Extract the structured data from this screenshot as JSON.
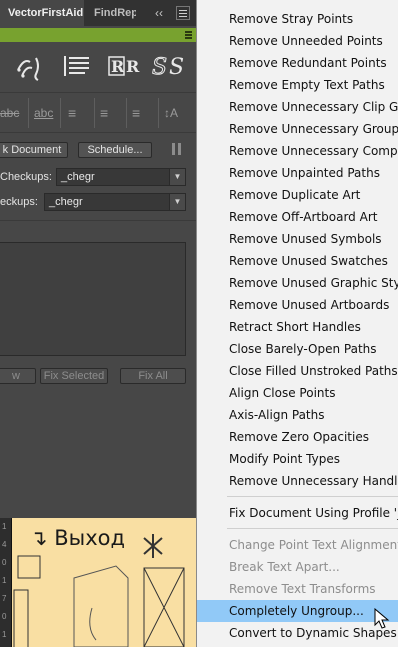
{
  "panel": {
    "tabs": [
      {
        "label": "VectorFirstAid",
        "active": true
      },
      {
        "label": "FindRep",
        "active": false
      }
    ],
    "collapse_icon_text": "‹‹",
    "toolbar_icons": [
      "path-tool-icon",
      "text-lines-icon",
      "raster-r-icon",
      "swatch-s-icon"
    ],
    "toolbar_glyphs": [
      "ᛋᛋ",
      "☰",
      "R R",
      "S S"
    ],
    "text_icons": [
      "abc",
      "abc",
      "≡",
      "≡",
      "≡",
      "↕A"
    ],
    "buttons": {
      "check_document": "k Document",
      "schedule": "Schedule...",
      "fix_row_left": "w",
      "fix_selected": "Fix Selected",
      "fix_all": "Fix All"
    },
    "checkups1": {
      "label": "Checkups:",
      "value": "_chegr"
    },
    "checkups2": {
      "label": "eckups:",
      "value": "_chegr"
    },
    "canvas_text": "↴ Выход",
    "ruler_labels": [
      "1",
      "4",
      "0",
      "1",
      "7",
      "0",
      "1"
    ],
    "accent_green": "#78a22f"
  },
  "menu": {
    "groups": [
      [
        {
          "label": "Remove Stray Points",
          "enabled": true
        },
        {
          "label": "Remove Unneeded Points",
          "enabled": true
        },
        {
          "label": "Remove Redundant Points",
          "enabled": true
        },
        {
          "label": "Remove Empty Text Paths",
          "enabled": true
        },
        {
          "label": "Remove Unnecessary Clip Groups",
          "enabled": true
        },
        {
          "label": "Remove Unnecessary Groups",
          "enabled": true
        },
        {
          "label": "Remove Unnecessary Compound",
          "enabled": true
        },
        {
          "label": "Remove Unpainted Paths",
          "enabled": true
        },
        {
          "label": "Remove Duplicate Art",
          "enabled": true
        },
        {
          "label": "Remove Off-Artboard Art",
          "enabled": true
        },
        {
          "label": "Remove Unused Symbols",
          "enabled": true
        },
        {
          "label": "Remove Unused Swatches",
          "enabled": true
        },
        {
          "label": "Remove Unused Graphic Styles",
          "enabled": true
        },
        {
          "label": "Remove Unused Artboards",
          "enabled": true
        },
        {
          "label": "Retract Short Handles",
          "enabled": true
        },
        {
          "label": "Close Barely-Open Paths",
          "enabled": true
        },
        {
          "label": "Close Filled Unstroked Paths",
          "enabled": true
        },
        {
          "label": "Align Close Points",
          "enabled": true
        },
        {
          "label": "Axis-Align Paths",
          "enabled": true
        },
        {
          "label": "Remove Zero Opacities",
          "enabled": true
        },
        {
          "label": "Modify Point Types",
          "enabled": true
        },
        {
          "label": "Remove Unnecessary Handles",
          "enabled": true
        }
      ],
      [
        {
          "label": "Fix Document Using Profile '_che",
          "enabled": true
        }
      ],
      [
        {
          "label": "Change Point Text Alignment...",
          "enabled": false
        },
        {
          "label": "Break Text Apart...",
          "enabled": false
        },
        {
          "label": "Remove Text Transforms",
          "enabled": false
        },
        {
          "label": "Completely Ungroup...",
          "enabled": true,
          "highlighted": true
        },
        {
          "label": "Convert to Dynamic Shapes",
          "enabled": true
        }
      ]
    ],
    "highlight_color": "#91c9f7"
  }
}
